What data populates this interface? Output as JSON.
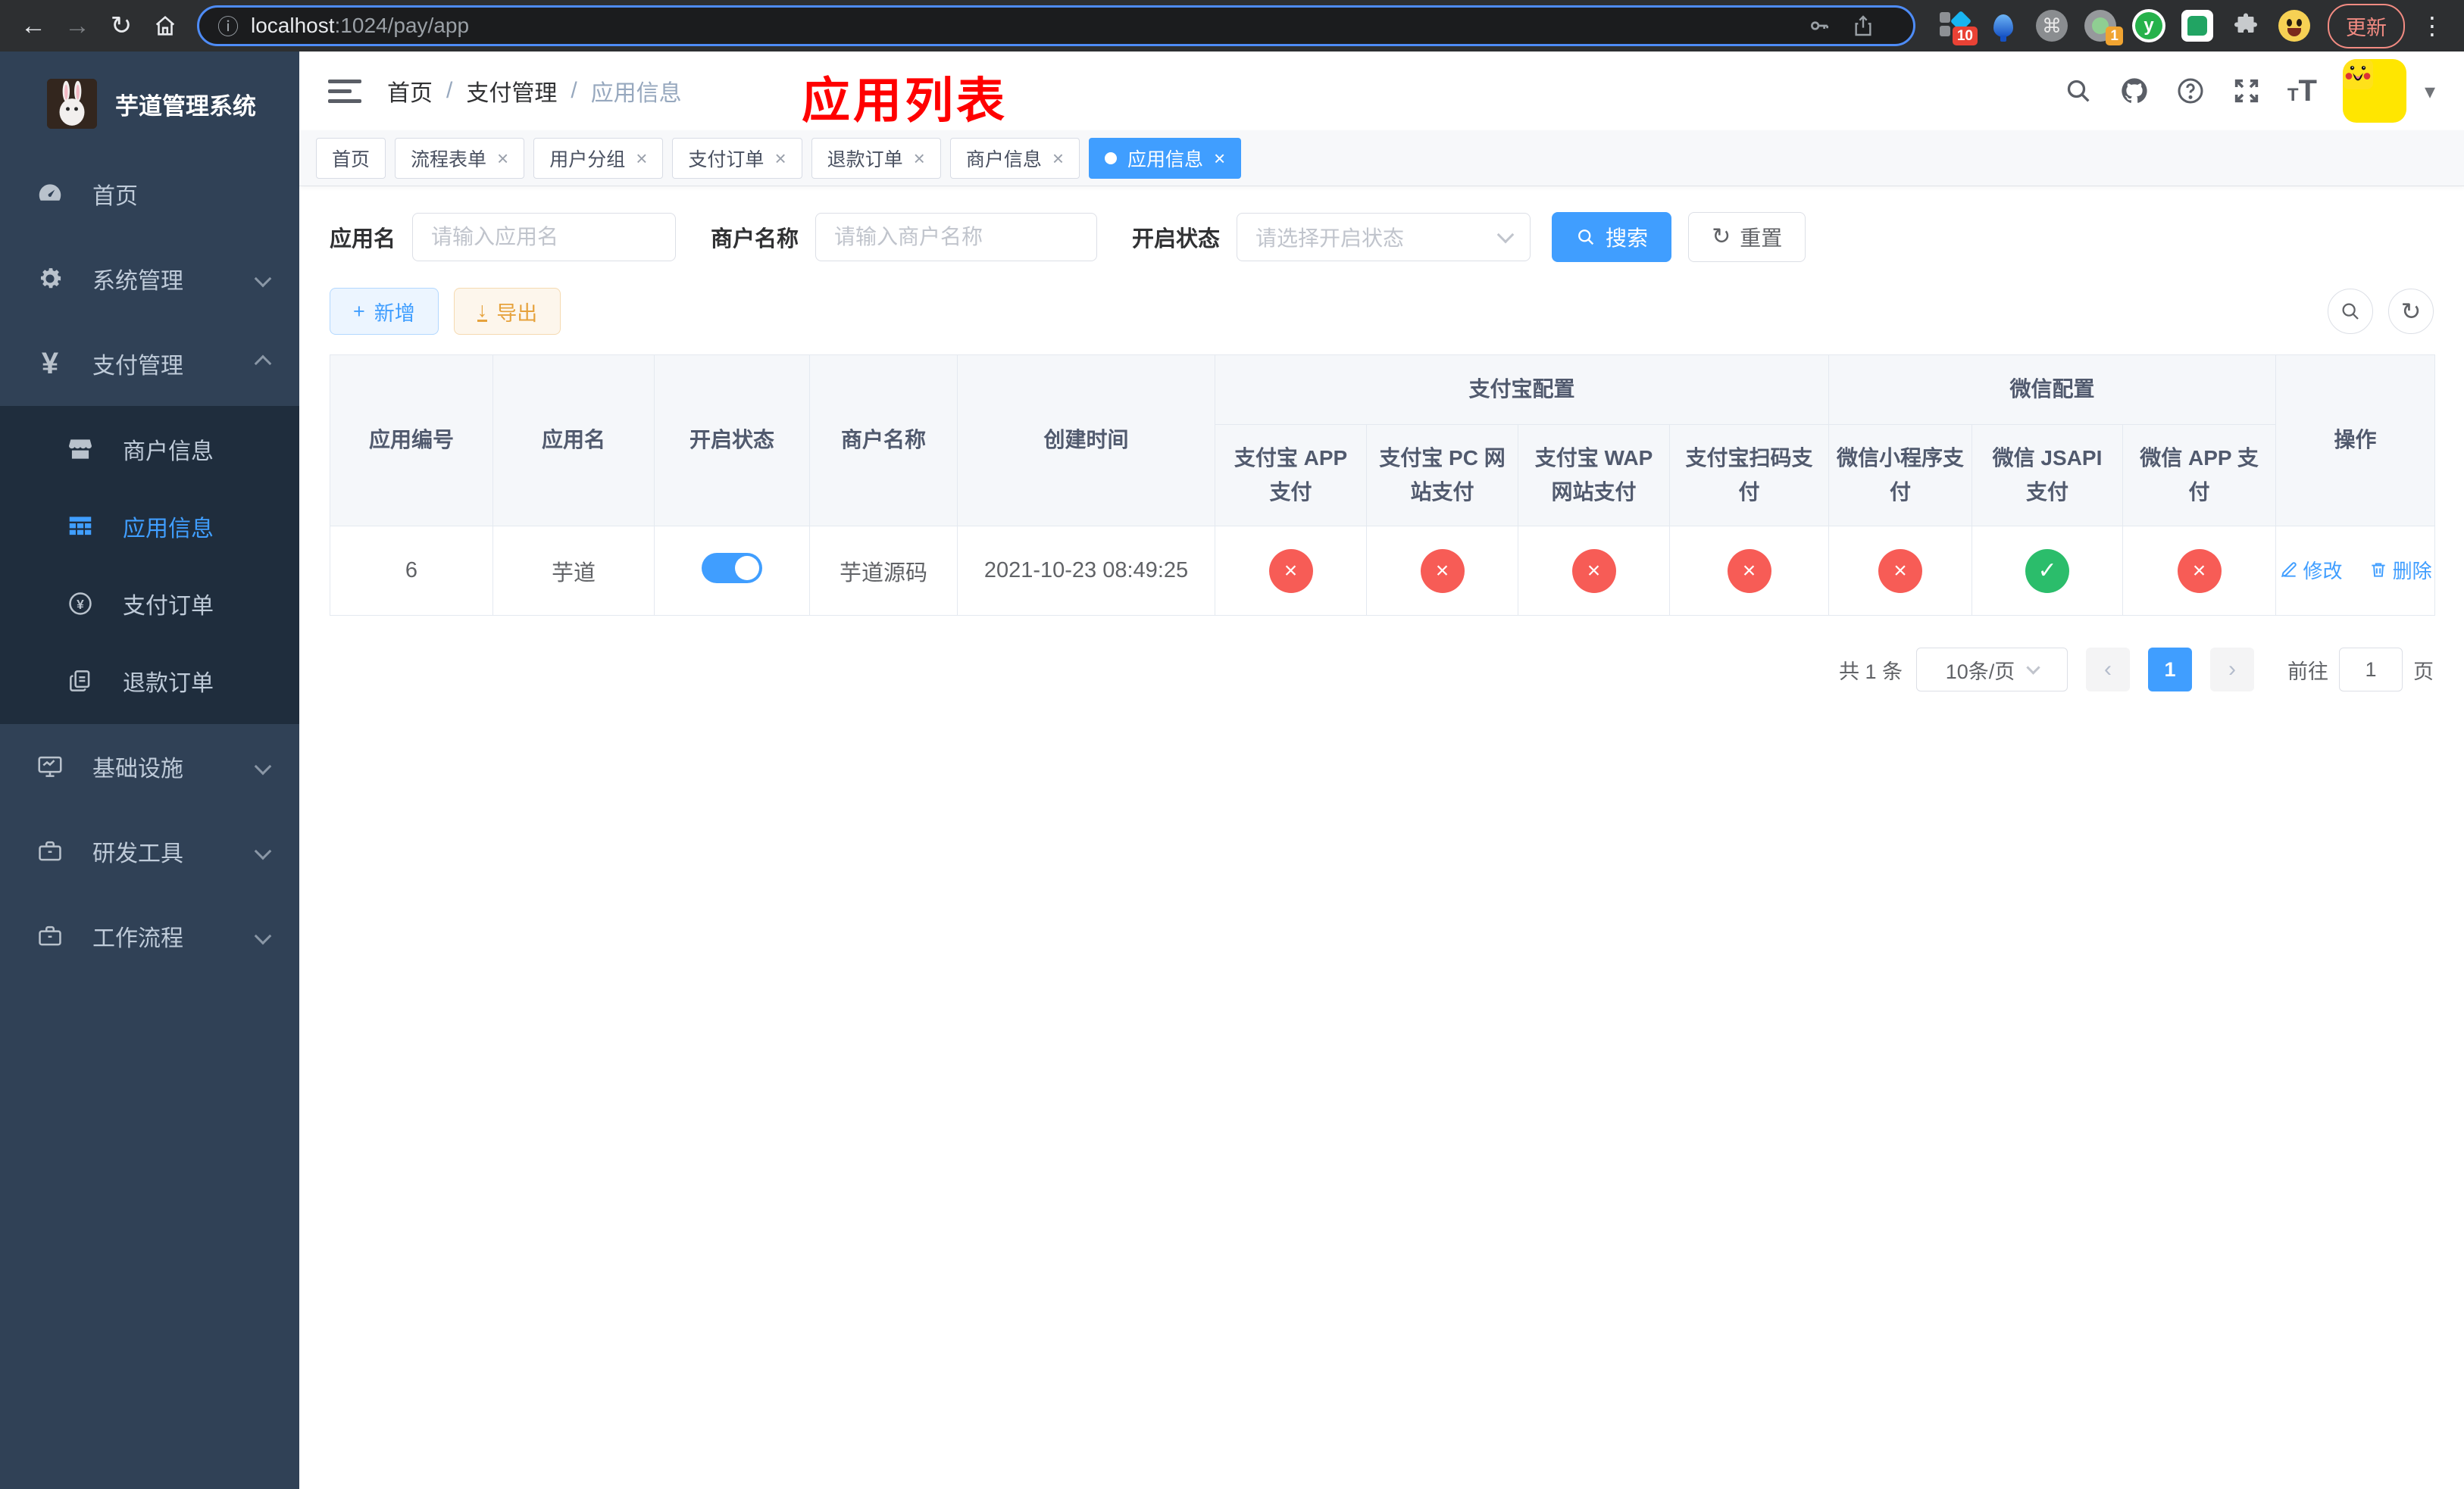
{
  "ui": {
    "back": "←",
    "forward": "→",
    "reload": "↻",
    "info": "ⓘ",
    "command": "⌘",
    "dots": "⋮",
    "caret": "▾",
    "close": "×",
    "fail": "×",
    "success": "✓",
    "plus": "+",
    "download": "↓",
    "refresh": "↻",
    "question": "?",
    "bc_sep": "/",
    "yen": "¥",
    "font_big": "T",
    "font_small": "T",
    "prev": "‹",
    "next": "›"
  },
  "browser": {
    "url_host": "localhost",
    "url_path": ":1024/pay/app",
    "ext_badge1": "10",
    "ext_badge2": "1",
    "ext_y": "y",
    "update_label": "更新"
  },
  "sidebar": {
    "title": "芋道管理系统",
    "menu": [
      {
        "label": "首页"
      },
      {
        "label": "系统管理"
      },
      {
        "label": "支付管理"
      }
    ],
    "submenu": [
      {
        "label": "商户信息"
      },
      {
        "label": "应用信息"
      },
      {
        "label": "支付订单"
      },
      {
        "label": "退款订单"
      }
    ],
    "menu2": [
      {
        "label": "基础设施"
      },
      {
        "label": "研发工具"
      },
      {
        "label": "工作流程"
      }
    ]
  },
  "header": {
    "breadcrumb": [
      {
        "label": "首页"
      },
      {
        "label": "支付管理"
      },
      {
        "label": "应用信息"
      }
    ],
    "overlay_title": "应用列表"
  },
  "tabs": [
    {
      "label": "首页",
      "closable": false,
      "active": false
    },
    {
      "label": "流程表单",
      "closable": true,
      "active": false
    },
    {
      "label": "用户分组",
      "closable": true,
      "active": false
    },
    {
      "label": "支付订单",
      "closable": true,
      "active": false
    },
    {
      "label": "退款订单",
      "closable": true,
      "active": false
    },
    {
      "label": "商户信息",
      "closable": true,
      "active": false
    },
    {
      "label": "应用信息",
      "closable": true,
      "active": true
    }
  ],
  "search": {
    "fields": [
      {
        "label": "应用名",
        "placeholder": "请输入应用名"
      },
      {
        "label": "商户名称",
        "placeholder": "请输入商户名称"
      },
      {
        "label": "开启状态",
        "placeholder": "请选择开启状态"
      }
    ],
    "search_label": "搜索",
    "reset_label": "重置"
  },
  "toolbar": {
    "add_label": "新增",
    "export_label": "导出"
  },
  "table": {
    "headers": {
      "simple": [
        "应用编号",
        "应用名",
        "开启状态",
        "商户名称",
        "创建时间"
      ],
      "group_alipay": "支付宝配置",
      "group_wechat": "微信配置",
      "alipay": [
        "支付宝 APP 支付",
        "支付宝 PC 网站支付",
        "支付宝 WAP 网站支付",
        "支付宝扫码支付"
      ],
      "wechat": [
        "微信小程序支付",
        "微信 JSAPI 支付",
        "微信 APP 支付"
      ],
      "action": "操作"
    },
    "row": {
      "id": "6",
      "name": "芋道",
      "enabled": true,
      "merchant": "芋道源码",
      "created": "2021-10-23 08:49:25",
      "statuses": [
        "fail",
        "fail",
        "fail",
        "fail",
        "fail",
        "success",
        "fail"
      ],
      "edit_label": "修改",
      "delete_label": "删除"
    }
  },
  "pagination": {
    "total": "共 1 条",
    "page_size": "10条/页",
    "current": "1",
    "goto_prefix": "前往",
    "goto_value": "1",
    "goto_suffix": "页"
  },
  "colors": {
    "accent": "#409eff",
    "danger": "#f75c56",
    "success": "#2bbd6b",
    "warning": "#e6a23c",
    "title_red": "#ff0000",
    "sidebar_bg": "#304156",
    "submenu_bg": "#1f2d3d"
  }
}
